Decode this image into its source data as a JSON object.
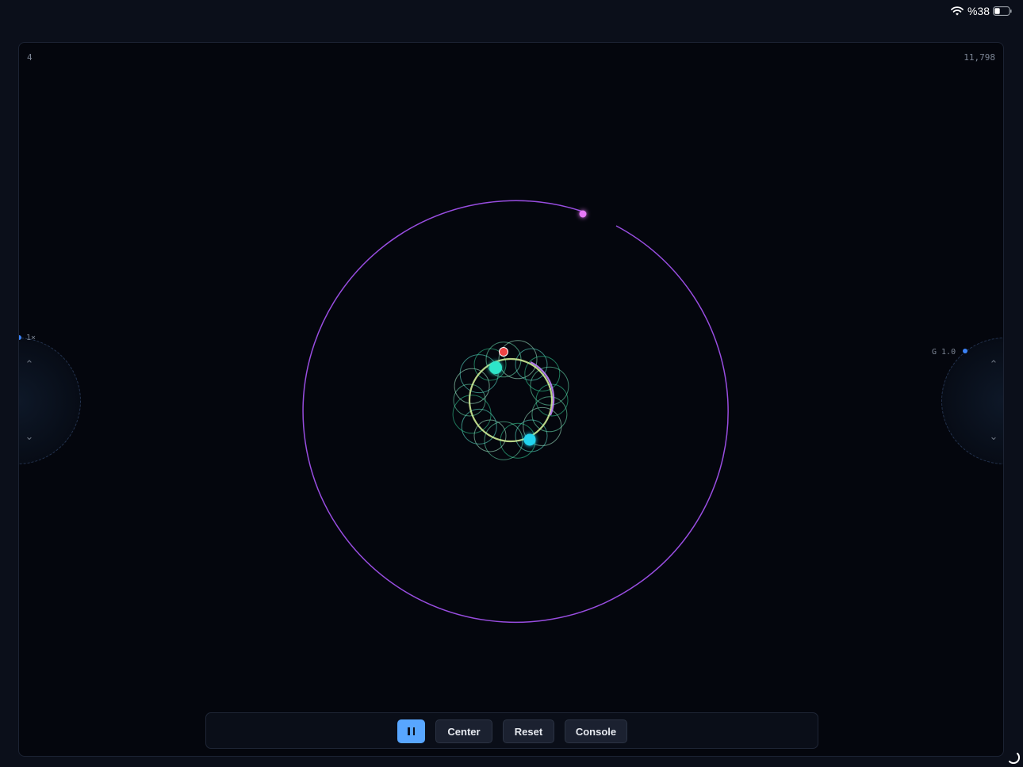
{
  "status": {
    "battery_text": "%38",
    "wifi_icon": "wifi-icon",
    "battery_icon": "battery-icon",
    "battery_level": 0.38
  },
  "hud": {
    "top_left": "4",
    "top_right": "11,798"
  },
  "dials": {
    "left": {
      "label": "1×",
      "up_icon": "chevron-up-icon",
      "down_icon": "chevron-down-icon"
    },
    "right": {
      "label": "G 1.0",
      "up_icon": "chevron-up-icon",
      "down_icon": "chevron-down-icon"
    }
  },
  "toolbar": {
    "pause_icon": "pause-icon",
    "center_label": "Center",
    "reset_label": "Reset",
    "console_label": "Console"
  },
  "colors": {
    "background": "#04060d",
    "accent": "#58a6ff",
    "outer_orbit": "#a855f7",
    "inner_trail": "#34d399",
    "inner_ring": "#d9f99d",
    "bodies": [
      "#e879f9",
      "#ef4444",
      "#2ee6c9",
      "#22d3ee"
    ]
  },
  "spinner_icon": "loading-spinner-icon"
}
